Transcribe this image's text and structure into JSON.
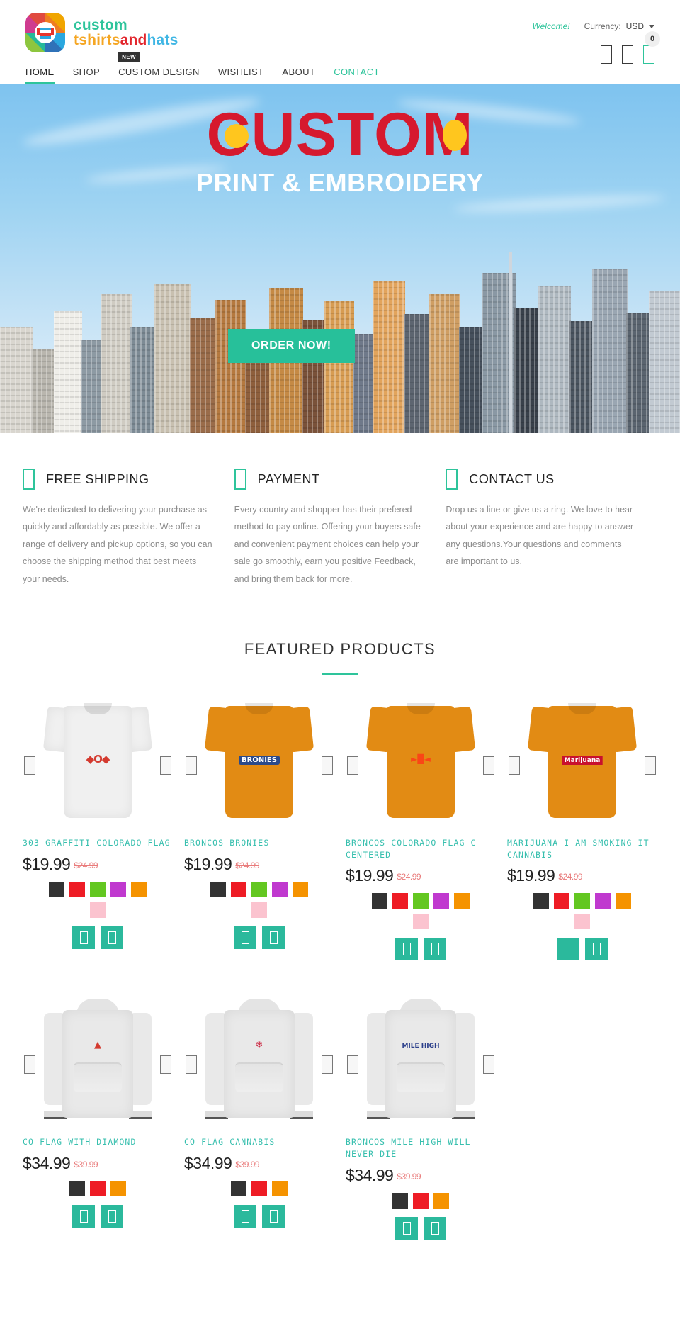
{
  "header": {
    "logo": {
      "line1": "custom",
      "line2_part1": "tshirts",
      "line2_part2": "and",
      "line2_part3": "hats",
      "icon": "tshirt-logo-icon"
    },
    "welcome": "Welcome!",
    "currency_label": "Currency:",
    "currency_value": "USD",
    "cart_count": "0",
    "icons": {
      "search": "search-icon",
      "account": "user-account-icon",
      "cart": "shopping-cart-icon"
    },
    "nav": [
      {
        "label": "HOME",
        "active": true,
        "badge": ""
      },
      {
        "label": "SHOP",
        "active": false,
        "badge": ""
      },
      {
        "label": "CUSTOM DESIGN",
        "active": false,
        "badge": "NEW"
      },
      {
        "label": "WISHLIST",
        "active": false,
        "badge": ""
      },
      {
        "label": "ABOUT",
        "active": false,
        "badge": ""
      },
      {
        "label": "CONTACT",
        "active": false,
        "badge": ""
      }
    ]
  },
  "hero": {
    "title": "CUSTOM",
    "subtitle": "PRINT & EMBROIDERY",
    "cta": "ORDER NOW!",
    "prev_icon": "chevron-left-icon",
    "next_icon": "chevron-right-icon"
  },
  "services": [
    {
      "icon": "truck-shipping-icon",
      "title": "FREE SHIPPING",
      "body": "We're dedicated to delivering your purchase as quickly and affordably as possible. We offer a range of delivery and pickup options, so you can choose the shipping method that best meets your needs."
    },
    {
      "icon": "credit-card-icon",
      "title": "PAYMENT",
      "body": "Every country and shopper has their prefered method to pay online. Offering your buyers safe and convenient payment choices can help your sale go smoothly, earn you positive Feedback, and bring them back for more."
    },
    {
      "icon": "phone-contact-icon",
      "title": "CONTACT US",
      "body": "Drop us a line or give us a ring. We love to hear about your experience and are happy to answer any questions.Your questions and comments are important to us."
    }
  ],
  "featured": {
    "heading": "FEATURED PRODUCTS",
    "products": [
      {
        "title": "303 GRAFFITI COLORADO FLAG",
        "price": "$19.99",
        "old_price": "$24.99",
        "garment": "tshirt",
        "garment_color": "#f0f0f0",
        "swatches": [
          "#333333",
          "#ee1c25",
          "#63c721",
          "#c039cf",
          "#f59300",
          "#fbc3cf"
        ],
        "actions": [
          "add-to-cart-icon",
          "quick-view-icon"
        ]
      },
      {
        "title": "BRONCOS BRONIES",
        "price": "$19.99",
        "old_price": "$24.99",
        "garment": "tshirt",
        "garment_color": "#e28b14",
        "swatches": [
          "#333333",
          "#ee1c25",
          "#63c721",
          "#c039cf",
          "#f59300",
          "#fbc3cf"
        ],
        "actions": [
          "add-to-cart-icon",
          "quick-view-icon"
        ]
      },
      {
        "title": "BRONCOS COLORADO FLAG C CENTERED",
        "price": "$19.99",
        "old_price": "$24.99",
        "garment": "tshirt",
        "garment_color": "#e28b14",
        "swatches": [
          "#333333",
          "#ee1c25",
          "#63c721",
          "#c039cf",
          "#f59300",
          "#fbc3cf"
        ],
        "actions": [
          "add-to-cart-icon",
          "quick-view-icon"
        ]
      },
      {
        "title": "MARIJUANA I AM SMOKING IT CANNABIS",
        "price": "$19.99",
        "old_price": "$24.99",
        "garment": "tshirt",
        "garment_color": "#e28b14",
        "swatches": [
          "#333333",
          "#ee1c25",
          "#63c721",
          "#c039cf",
          "#f59300",
          "#fbc3cf"
        ],
        "actions": [
          "add-to-cart-icon",
          "quick-view-icon"
        ]
      },
      {
        "title": "CO FLAG WITH DIAMOND",
        "price": "$34.99",
        "old_price": "$39.99",
        "garment": "hoodie",
        "garment_color": "#e9e9e9",
        "swatches": [
          "#333333",
          "#ee1c25",
          "#f59300"
        ],
        "actions": [
          "add-to-cart-icon",
          "quick-view-icon"
        ]
      },
      {
        "title": "CO FLAG CANNABIS",
        "price": "$34.99",
        "old_price": "$39.99",
        "garment": "hoodie",
        "garment_color": "#e9e9e9",
        "swatches": [
          "#333333",
          "#ee1c25",
          "#f59300"
        ],
        "actions": [
          "add-to-cart-icon",
          "quick-view-icon"
        ]
      },
      {
        "title": "BRONCOS MILE HIGH WILL NEVER DIE",
        "price": "$34.99",
        "old_price": "$39.99",
        "garment": "hoodie",
        "garment_color": "#e9e9e9",
        "swatches": [
          "#333333",
          "#ee1c25",
          "#f59300"
        ],
        "actions": [
          "add-to-cart-icon",
          "quick-view-icon"
        ]
      }
    ]
  },
  "colors": {
    "accent_teal": "#2ec49b",
    "title_teal": "#37bfae",
    "hero_red": "#d6192e",
    "hero_yellow": "#ffc61e",
    "old_price_red": "#e97b7b"
  }
}
